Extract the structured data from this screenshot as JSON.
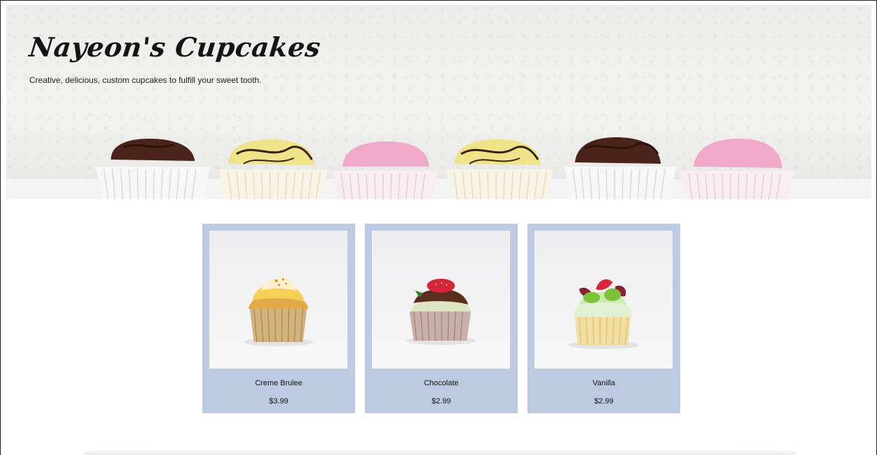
{
  "header": {
    "title": "Nayeon's Cupcakes",
    "tagline": "Creative, delicious, custom cupcakes to fulfill your sweet tooth."
  },
  "products": [
    {
      "name": "Creme Brulee",
      "price": "$3.99"
    },
    {
      "name": "Chocolate",
      "price": "$2.99"
    },
    {
      "name": "Vanilla",
      "price": "$2.99"
    }
  ],
  "colors": {
    "card_background": "#bccbe2",
    "text": "#111111",
    "page_background": "#ffffff"
  }
}
